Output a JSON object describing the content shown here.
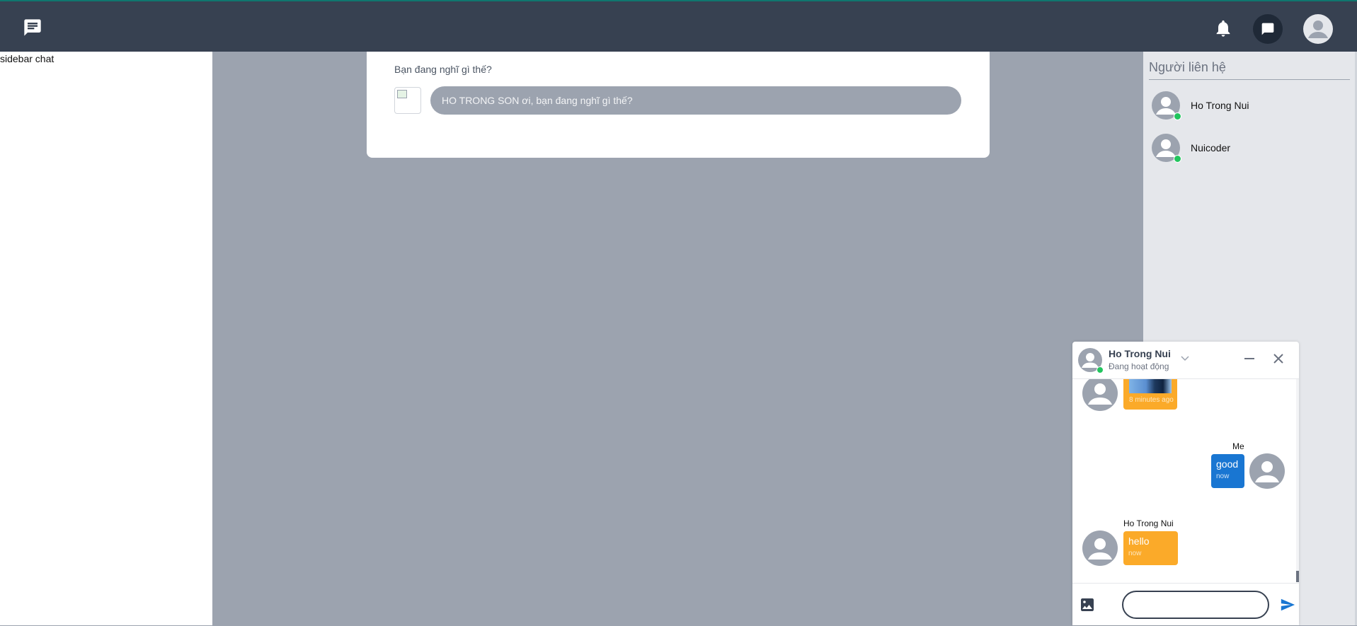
{
  "topbar": {
    "logo_icon": "chat-lines-icon",
    "notification_icon": "bell-icon",
    "messages_icon": "message-icon",
    "account_icon": "user-avatar-icon"
  },
  "left_sidebar": {
    "label": "sidebar chat"
  },
  "post": {
    "question": "Bạn đang nghĩ gì thế?",
    "input_placeholder": "HO TRONG SON ơi, bạn đang nghĩ gì thế?"
  },
  "contacts": {
    "title": "Người liên hệ",
    "items": [
      {
        "name": "Ho Trong Nui",
        "online": true
      },
      {
        "name": "Nuicoder",
        "online": true
      }
    ]
  },
  "chat": {
    "header": {
      "name": "Ho Trong Nui",
      "status": "Đang hoạt động"
    },
    "messages": [
      {
        "from": "Ho Trong Nui",
        "type": "image",
        "time": "8 minutes ago"
      },
      {
        "from": "Me",
        "sender_label": "Me",
        "text": "good",
        "time": "now"
      },
      {
        "from": "Ho Trong Nui",
        "sender_label": "Ho Trong Nui",
        "text": "hello",
        "time": "now"
      }
    ],
    "input_value": ""
  },
  "colors": {
    "topbar": "#374151",
    "main_bg": "#9ca3af",
    "incoming_bubble": "#fbaa29",
    "outgoing_bubble": "#1976d2",
    "online": "#22c55e"
  }
}
